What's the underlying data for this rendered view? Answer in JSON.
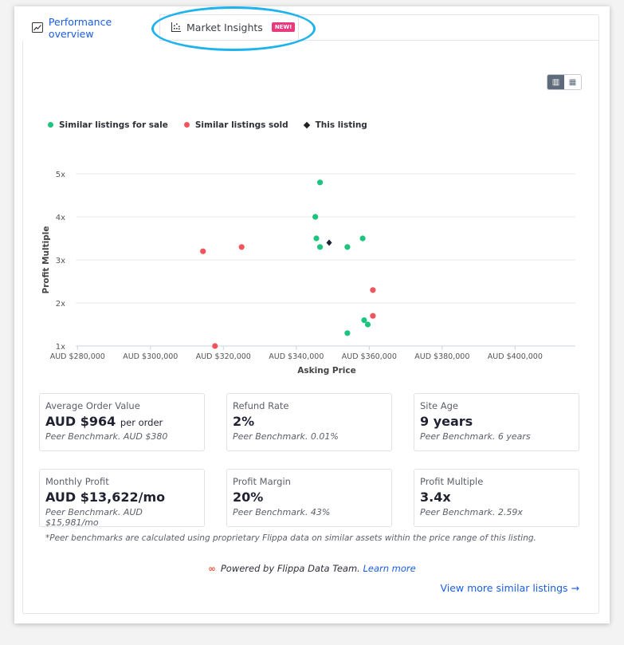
{
  "tabs": [
    {
      "label": "Performance overview",
      "icon": "line-chart-icon",
      "active": false
    },
    {
      "label": "Market Insights",
      "icon": "scatter-icon",
      "badge": "NEW!",
      "active": true
    }
  ],
  "view_toggle": {
    "options": [
      "chart-icon",
      "table-icon"
    ],
    "selected": "chart"
  },
  "colors": {
    "for_sale": "#1cc47e",
    "sold": "#f2545b",
    "this_listing": "#1f2230",
    "link": "#1a5ce6",
    "annotation": "#1fb3ee"
  },
  "chart_data": {
    "type": "scatter",
    "xlabel": "Asking Price",
    "ylabel": "Profit Multiple",
    "xlim": [
      279500,
      418500
    ],
    "ylim": [
      1,
      5
    ],
    "xticks": [
      280000,
      300000,
      320000,
      340000,
      360000,
      380000,
      400000
    ],
    "xtick_labels": [
      "AUD $280,000",
      "AUD $300,000",
      "AUD $320,000",
      "AUD $340,000",
      "AUD $360,000",
      "AUD $380,000",
      "AUD $400,000"
    ],
    "yticks": [
      1,
      2,
      3,
      4,
      5
    ],
    "ytick_labels": [
      "1x",
      "2x",
      "3x",
      "4x",
      "5x"
    ],
    "grid": "horizontal",
    "legend": "top-left",
    "series": [
      {
        "name": "Similar listings for sale",
        "marker": "circle",
        "points": [
          [
            346500,
            4.8
          ],
          [
            345200,
            4.0
          ],
          [
            345500,
            3.5
          ],
          [
            346500,
            3.3
          ],
          [
            354000,
            3.3
          ],
          [
            358200,
            3.5
          ],
          [
            358600,
            1.6
          ],
          [
            359600,
            1.5
          ],
          [
            354000,
            1.3
          ]
        ]
      },
      {
        "name": "Similar listings sold",
        "marker": "circle",
        "points": [
          [
            314400,
            3.2
          ],
          [
            325000,
            3.3
          ],
          [
            361000,
            2.3
          ],
          [
            361000,
            1.7
          ],
          [
            317700,
            1.0
          ]
        ]
      },
      {
        "name": "This listing",
        "marker": "diamond",
        "points": [
          [
            349000,
            3.4
          ]
        ]
      }
    ]
  },
  "cards": [
    {
      "label": "Average Order Value",
      "value": "AUD $964",
      "suffix": "per order",
      "benchmark": "Peer Benchmark. AUD $380"
    },
    {
      "label": "Refund Rate",
      "value": "2%",
      "suffix": "",
      "benchmark": "Peer Benchmark. 0.01%"
    },
    {
      "label": "Site Age",
      "value": "9 years",
      "suffix": "",
      "benchmark": "Peer Benchmark. 6 years"
    },
    {
      "label": "Monthly Profit",
      "value": "AUD $13,622/mo",
      "suffix": "",
      "benchmark": "Peer Benchmark. AUD $15,981/mo"
    },
    {
      "label": "Profit Margin",
      "value": "20%",
      "suffix": "",
      "benchmark": "Peer Benchmark. 43%"
    },
    {
      "label": "Profit Multiple",
      "value": "3.4x",
      "suffix": "",
      "benchmark": "Peer Benchmark. 2.59x"
    }
  ],
  "footnote": "*Peer benchmarks are calculated using proprietary Flippa data on similar assets within the price range of this listing.",
  "powered": {
    "text": "Powered by Flippa Data Team.",
    "link": "Learn more"
  },
  "more_link": "View more similar listings →"
}
